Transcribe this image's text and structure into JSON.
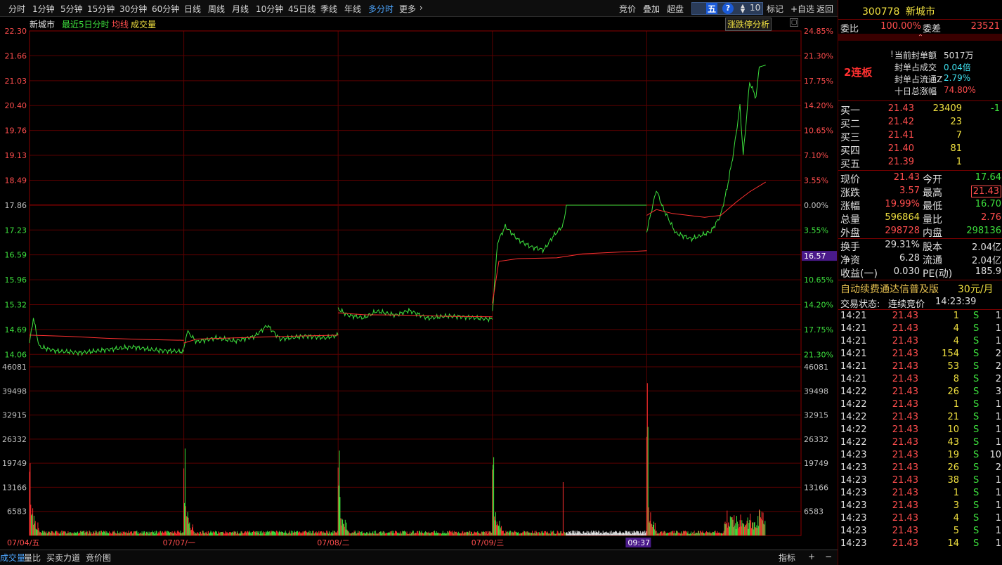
{
  "tabs": [
    "分时",
    "1分钟",
    "5分钟",
    "15分钟",
    "30分钟",
    "60分钟",
    "日线",
    "周线",
    "月线",
    "10分钟",
    "45日线",
    "季线",
    "年线",
    "多分时",
    "更多"
  ],
  "more_chevron": "›",
  "toolbar_right": {
    "jingjia": "竞价",
    "diejia": "叠加",
    "chaopan": "超盘",
    "wu": "五",
    "help": "?",
    "num": "10",
    "biaoji": "标记",
    "zixuan": "+自选",
    "fanhui": "返回"
  },
  "chart_header": {
    "name": "新城市",
    "mode": "最近5日分时",
    "avg": "均线",
    "vol": "成交量",
    "analysis": "涨跌停分析"
  },
  "price_axis": [
    "22.30",
    "21.66",
    "21.03",
    "20.40",
    "19.76",
    "19.13",
    "18.49",
    "17.86",
    "17.23",
    "16.59",
    "15.96",
    "15.32",
    "14.69",
    "14.06"
  ],
  "pct_axis": [
    "24.85%",
    "21.30%",
    "17.75%",
    "14.20%",
    "10.65%",
    "7.10%",
    "3.55%",
    "0.00%",
    "3.55%",
    "7.10%",
    "10.65%",
    "14.20%",
    "17.75%",
    "21.30%"
  ],
  "crosshair_price": "16.57",
  "vol_axis": [
    "46081",
    "39498",
    "32915",
    "26332",
    "19749",
    "13166",
    "6583"
  ],
  "dates": [
    "07/04/五",
    "07/07/一",
    "07/08/二",
    "07/09/三"
  ],
  "crosshair_time": "09:37",
  "bottom_tabs": [
    "成交量",
    "量比",
    "买卖力道",
    "竞价图"
  ],
  "bottom_right": {
    "zhibiao": "指标",
    "plus": "+",
    "minus": "−"
  },
  "stock": {
    "code": "300778",
    "name": "新城市"
  },
  "weibi": {
    "label": "委比",
    "value": "100.00%",
    "diff_label": "委差",
    "diff": "23521"
  },
  "collapse_icon": "⌃",
  "board": "2连板",
  "seal": [
    {
      "label": "当前封单额",
      "value": "5017万",
      "color": "#e0e0e0",
      "icon": "!"
    },
    {
      "label": "封单占成交",
      "value": "0.04倍",
      "color": "#3ee0ee"
    },
    {
      "label": "封单占流通Z",
      "value": "2.79%",
      "color": "#3ee0ee"
    },
    {
      "label": "十日总涨幅",
      "value": "74.80%",
      "color": "#ff4d4d"
    }
  ],
  "bids": [
    {
      "label": "买一",
      "price": "21.43",
      "vol": "23409",
      "chg": "-1"
    },
    {
      "label": "买二",
      "price": "21.42",
      "vol": "23",
      "chg": ""
    },
    {
      "label": "买三",
      "price": "21.41",
      "vol": "7",
      "chg": ""
    },
    {
      "label": "买四",
      "price": "21.40",
      "vol": "81",
      "chg": ""
    },
    {
      "label": "买五",
      "price": "21.39",
      "vol": "1",
      "chg": ""
    }
  ],
  "quote": [
    {
      "l1": "现价",
      "v1": "21.43",
      "c1": "#ff4d4d",
      "l2": "今开",
      "v2": "17.64",
      "c2": "#3de03d"
    },
    {
      "l1": "涨跌",
      "v1": "3.57",
      "c1": "#ff4d4d",
      "l2": "最高",
      "v2": "21.43",
      "c2": "#ff4d4d"
    },
    {
      "l1": "涨幅",
      "v1": "19.99%",
      "c1": "#ff4d4d",
      "l2": "最低",
      "v2": "16.70",
      "c2": "#3de03d"
    },
    {
      "l1": "总量",
      "v1": "596864",
      "c1": "#f0e040",
      "l2": "量比",
      "v2": "2.76",
      "c2": "#ff4d4d"
    },
    {
      "l1": "外盘",
      "v1": "298728",
      "c1": "#ff4d4d",
      "l2": "内盘",
      "v2": "298136",
      "c2": "#3de03d"
    }
  ],
  "fund": [
    {
      "l1": "换手",
      "v1": "29.31%",
      "l2": "股本",
      "v2": "2.04亿"
    },
    {
      "l1": "净资",
      "v1": "6.28",
      "l2": "流通",
      "v2": "2.04亿"
    },
    {
      "l1": "收益(一)",
      "v1": "0.030",
      "l2": "PE(动)",
      "v2": "185.9"
    }
  ],
  "promo": {
    "text": "自动续费通达信普及版",
    "price": "30元/月"
  },
  "trade_status": {
    "label": "交易状态:",
    "value": "连续竞价",
    "time": "14:23:39"
  },
  "ticks": [
    {
      "t": "14:21",
      "p": "21.43",
      "v": "1",
      "s": "S",
      "n": "1"
    },
    {
      "t": "14:21",
      "p": "21.43",
      "v": "4",
      "s": "S",
      "n": "1"
    },
    {
      "t": "14:21",
      "p": "21.43",
      "v": "4",
      "s": "S",
      "n": "1"
    },
    {
      "t": "14:21",
      "p": "21.43",
      "v": "154",
      "s": "S",
      "n": "2"
    },
    {
      "t": "14:21",
      "p": "21.43",
      "v": "53",
      "s": "S",
      "n": "2"
    },
    {
      "t": "14:21",
      "p": "21.43",
      "v": "8",
      "s": "S",
      "n": "2"
    },
    {
      "t": "14:22",
      "p": "21.43",
      "v": "26",
      "s": "S",
      "n": "3"
    },
    {
      "t": "14:22",
      "p": "21.43",
      "v": "1",
      "s": "S",
      "n": "1"
    },
    {
      "t": "14:22",
      "p": "21.43",
      "v": "21",
      "s": "S",
      "n": "1"
    },
    {
      "t": "14:22",
      "p": "21.43",
      "v": "10",
      "s": "S",
      "n": "1"
    },
    {
      "t": "14:22",
      "p": "21.43",
      "v": "43",
      "s": "S",
      "n": "1"
    },
    {
      "t": "14:23",
      "p": "21.43",
      "v": "19",
      "s": "S",
      "n": "10"
    },
    {
      "t": "14:23",
      "p": "21.43",
      "v": "26",
      "s": "S",
      "n": "2"
    },
    {
      "t": "14:23",
      "p": "21.43",
      "v": "38",
      "s": "S",
      "n": "1"
    },
    {
      "t": "14:23",
      "p": "21.43",
      "v": "1",
      "s": "S",
      "n": "1"
    },
    {
      "t": "14:23",
      "p": "21.43",
      "v": "3",
      "s": "S",
      "n": "1"
    },
    {
      "t": "14:23",
      "p": "21.43",
      "v": "4",
      "s": "S",
      "n": "1"
    },
    {
      "t": "14:23",
      "p": "21.43",
      "v": "5",
      "s": "S",
      "n": "1"
    },
    {
      "t": "14:23",
      "p": "21.43",
      "v": "14",
      "s": "S",
      "n": "1"
    }
  ],
  "chart_data": {
    "type": "line",
    "title": "新城市 最近5日分时",
    "prev_close": 17.86,
    "ylim": [
      14.06,
      22.3
    ],
    "limit_price": 21.43,
    "days": [
      {
        "date": "07/04/五",
        "open": 14.35,
        "points": [
          [
            0,
            14.35
          ],
          [
            6,
            14.99
          ],
          [
            15,
            14.26
          ],
          [
            40,
            14.15
          ],
          [
            80,
            14.1
          ],
          [
            120,
            14.18
          ],
          [
            160,
            14.25
          ],
          [
            200,
            14.16
          ],
          [
            240,
            14.13
          ]
        ],
        "avg": [
          [
            0,
            14.55
          ],
          [
            60,
            14.52
          ],
          [
            120,
            14.47
          ],
          [
            180,
            14.44
          ],
          [
            240,
            14.42
          ]
        ]
      },
      {
        "date": "07/07/一",
        "points": [
          [
            0,
            14.18
          ],
          [
            5,
            14.65
          ],
          [
            20,
            14.38
          ],
          [
            50,
            14.48
          ],
          [
            80,
            14.4
          ],
          [
            110,
            14.52
          ],
          [
            130,
            14.8
          ],
          [
            150,
            14.45
          ],
          [
            190,
            14.53
          ],
          [
            220,
            14.48
          ],
          [
            240,
            14.55
          ]
        ],
        "avg": [
          [
            0,
            14.35
          ],
          [
            20,
            14.45
          ],
          [
            80,
            14.48
          ],
          [
            160,
            14.52
          ],
          [
            240,
            14.55
          ]
        ]
      },
      {
        "date": "07/08/二",
        "points": [
          [
            0,
            15.22
          ],
          [
            15,
            15.06
          ],
          [
            40,
            14.99
          ],
          [
            60,
            15.16
          ],
          [
            90,
            15.06
          ],
          [
            110,
            15.18
          ],
          [
            140,
            14.98
          ],
          [
            170,
            15.04
          ],
          [
            200,
            15.01
          ],
          [
            240,
            14.95
          ]
        ],
        "avg": [
          [
            0,
            15.12
          ],
          [
            40,
            15.07
          ],
          [
            100,
            15.06
          ],
          [
            170,
            15.03
          ],
          [
            240,
            15.02
          ]
        ]
      },
      {
        "date": "07/09/三",
        "points": [
          [
            0,
            15.16
          ],
          [
            8,
            16.92
          ],
          [
            20,
            17.32
          ],
          [
            40,
            16.98
          ],
          [
            60,
            16.8
          ],
          [
            80,
            16.72
          ],
          [
            95,
            17.08
          ],
          [
            110,
            17.35
          ],
          [
            115,
            17.86
          ],
          [
            240,
            17.86
          ]
        ],
        "avg": [
          [
            0,
            15.36
          ],
          [
            10,
            16.43
          ],
          [
            40,
            16.5
          ],
          [
            100,
            16.52
          ],
          [
            140,
            16.62
          ],
          [
            240,
            16.7
          ]
        ]
      },
      {
        "date": "today",
        "points": [
          [
            0,
            17.2
          ],
          [
            8,
            17.76
          ],
          [
            15,
            18.25
          ],
          [
            25,
            17.8
          ],
          [
            45,
            17.15
          ],
          [
            70,
            17.0
          ],
          [
            100,
            17.19
          ],
          [
            115,
            17.6
          ],
          [
            125,
            18.3
          ],
          [
            135,
            19.2
          ],
          [
            145,
            20.4
          ],
          [
            150,
            19.13
          ],
          [
            160,
            21.0
          ],
          [
            170,
            20.6
          ],
          [
            175,
            21.38
          ],
          [
            185,
            21.43
          ]
        ],
        "avg": [
          [
            0,
            17.6
          ],
          [
            15,
            17.75
          ],
          [
            40,
            17.65
          ],
          [
            90,
            17.55
          ],
          [
            115,
            17.6
          ],
          [
            140,
            17.95
          ],
          [
            160,
            18.2
          ],
          [
            185,
            18.45
          ]
        ]
      }
    ],
    "volume_ylim": [
      0,
      46081
    ],
    "volume_note": "per-minute volume bars; peaks near open of each day"
  }
}
